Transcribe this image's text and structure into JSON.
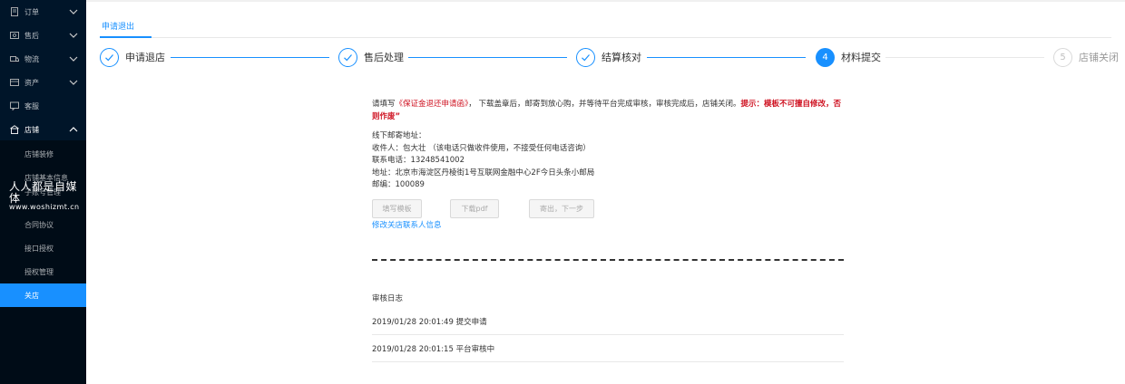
{
  "sidebar": {
    "items": [
      {
        "label": "订单",
        "icon": "document-icon",
        "has_arrow": true
      },
      {
        "label": "售后",
        "icon": "service-icon",
        "has_arrow": true
      },
      {
        "label": "物流",
        "icon": "truck-icon",
        "has_arrow": true
      },
      {
        "label": "资产",
        "icon": "wallet-icon",
        "has_arrow": true
      },
      {
        "label": "客服",
        "icon": "chat-icon",
        "has_arrow": false
      },
      {
        "label": "店铺",
        "icon": "shop-icon",
        "has_arrow": true
      }
    ],
    "sub_items": [
      {
        "label": "店铺装修"
      },
      {
        "label": "店铺基本信息"
      },
      {
        "label": "子账号管理"
      },
      {
        "label": "合同协议"
      },
      {
        "label": "接口授权"
      },
      {
        "label": "授权管理"
      },
      {
        "label": "关店"
      }
    ],
    "watermark": {
      "line1": "人人都是自媒体",
      "line2": "www.woshizmt.cn"
    }
  },
  "tab": {
    "label": "申请退出"
  },
  "steps": [
    {
      "label": "申请退店",
      "status": "finish"
    },
    {
      "label": "售后处理",
      "status": "finish"
    },
    {
      "label": "结算核对",
      "status": "finish"
    },
    {
      "label": "材料提交",
      "status": "process",
      "number": "4"
    },
    {
      "label": "店铺关闭",
      "status": "wait",
      "number": "5"
    }
  ],
  "notice": {
    "prefix": "请填写",
    "doc_name": "《保证金退还申请函》",
    "middle": "， 下载盖章后，邮寄到放心购，并等待平台完成审核，审核完成后，店铺关闭。",
    "warning": "提示：模板不可擅自修改，否则作废”"
  },
  "address": {
    "title": "线下邮寄地址：",
    "recipient": "收件人：包大壮 （该电话只做收件使用，不接受任何电话咨询）",
    "phone": "联系电话：13248541002",
    "address": "地址：北京市海淀区丹棱街1号互联网金融中心2F今日头条小邮局",
    "postcode": "邮编：100089"
  },
  "buttons": {
    "fill": "填写模板",
    "download": "下载pdf",
    "send": "寄出，下一步"
  },
  "link": {
    "label": "修改关店联系人信息"
  },
  "log": {
    "title": "审核日志",
    "entries": [
      {
        "text": "2019/01/28 20:01:49 提交申请"
      },
      {
        "text": "2019/01/28 20:01:15 平台审核中"
      }
    ]
  },
  "colors": {
    "primary": "#1890ff",
    "sidebar": "#001529",
    "submenu": "#000c17",
    "warning": "#cf1322"
  }
}
